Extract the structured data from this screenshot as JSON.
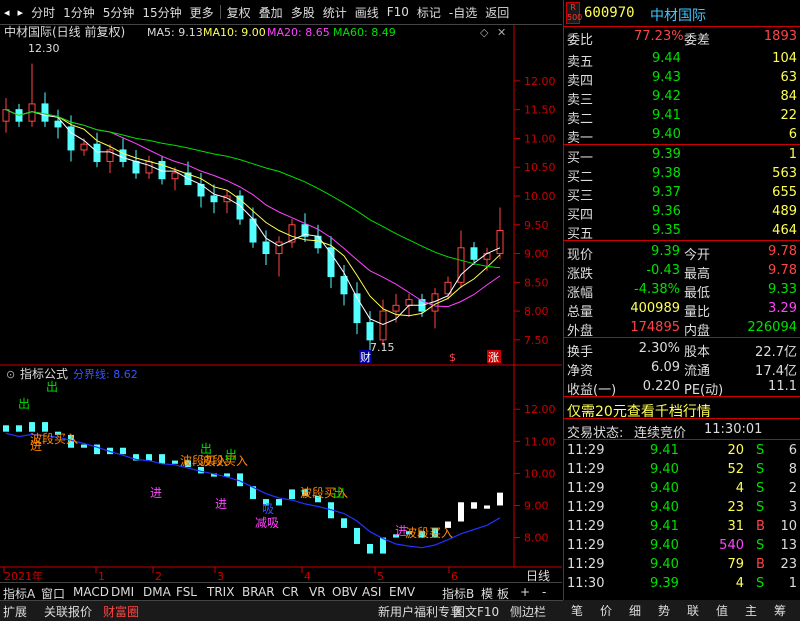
{
  "toolbar": {
    "items": [
      "分时",
      "1分钟",
      "5分钟",
      "15分钟",
      "更多",
      "复权",
      "叠加",
      "多股",
      "统计",
      "画线",
      "F10",
      "标记",
      "-自选",
      "返回"
    ]
  },
  "main_chart": {
    "title": "中材国际(日线 前复权)",
    "ma5": "MA5: 9.13",
    "ma10": "MA10: 9.00",
    "ma20": "MA20: 8.65",
    "ma60": "MA60: 8.49",
    "high_label": "12.30",
    "low_label": "7.15",
    "y_ticks": [
      "12.00",
      "11.50",
      "11.00",
      "10.50",
      "10.00",
      "9.50",
      "9.00",
      "8.50",
      "8.00",
      "7.50"
    ],
    "y_min": 7.15,
    "y_max": 12.45,
    "markers": [
      "财",
      "$",
      "涨"
    ]
  },
  "sub_chart": {
    "title": "指标公式",
    "line_label": "分界线: 8.62",
    "y_ticks": [
      "12.00",
      "11.00",
      "10.00",
      "9.00",
      "8.00"
    ],
    "y_min": 7.3,
    "y_max": 12.6,
    "signals": [
      "出",
      "波段买入",
      "进",
      "进",
      "出",
      "波段买入",
      "进",
      "波段买入",
      "减吸",
      "吸",
      "出",
      "进",
      "波段买入",
      "波段买入",
      "出",
      "出"
    ]
  },
  "x_axis": {
    "labels": [
      "2021年",
      "1",
      "2",
      "3",
      "4",
      "5",
      "6"
    ],
    "right": "日线"
  },
  "chart_data": {
    "type": "candlestick",
    "title": "中材国际(日线 前复权)",
    "x_labels": [
      "2021年",
      "1",
      "2",
      "3",
      "4",
      "5",
      "6"
    ],
    "ylim": [
      7.15,
      12.45
    ],
    "y_ticks": [
      12.0,
      11.5,
      11.0,
      10.5,
      10.0,
      9.5,
      9.0,
      8.5,
      8.0,
      7.5
    ],
    "ohlc": [
      [
        11.3,
        11.7,
        11.1,
        11.5
      ],
      [
        11.5,
        11.6,
        11.2,
        11.3
      ],
      [
        11.3,
        12.3,
        11.2,
        11.6
      ],
      [
        11.6,
        11.8,
        11.2,
        11.3
      ],
      [
        11.3,
        11.5,
        11.0,
        11.2
      ],
      [
        11.2,
        11.4,
        10.6,
        10.8
      ],
      [
        10.8,
        11.0,
        10.7,
        10.9
      ],
      [
        10.9,
        11.1,
        10.5,
        10.6
      ],
      [
        10.6,
        10.9,
        10.4,
        10.8
      ],
      [
        10.8,
        11.0,
        10.5,
        10.6
      ],
      [
        10.6,
        10.8,
        10.3,
        10.4
      ],
      [
        10.4,
        10.7,
        10.3,
        10.6
      ],
      [
        10.6,
        10.7,
        10.2,
        10.3
      ],
      [
        10.3,
        10.5,
        10.1,
        10.4
      ],
      [
        10.4,
        10.6,
        10.2,
        10.2
      ],
      [
        10.2,
        10.4,
        9.8,
        10.0
      ],
      [
        10.0,
        10.2,
        9.7,
        9.9
      ],
      [
        9.9,
        10.1,
        9.7,
        10.0
      ],
      [
        10.0,
        10.1,
        9.5,
        9.6
      ],
      [
        9.6,
        9.8,
        9.1,
        9.2
      ],
      [
        9.2,
        9.4,
        8.8,
        9.0
      ],
      [
        9.0,
        9.3,
        8.6,
        9.2
      ],
      [
        9.2,
        9.6,
        9.1,
        9.5
      ],
      [
        9.5,
        9.7,
        9.2,
        9.3
      ],
      [
        9.3,
        9.5,
        9.0,
        9.1
      ],
      [
        9.1,
        9.3,
        8.4,
        8.6
      ],
      [
        8.6,
        8.8,
        8.1,
        8.3
      ],
      [
        8.3,
        8.5,
        7.6,
        7.8
      ],
      [
        7.8,
        8.0,
        7.15,
        7.5
      ],
      [
        7.5,
        8.2,
        7.4,
        8.0
      ],
      [
        8.0,
        8.3,
        7.8,
        8.1
      ],
      [
        8.1,
        8.3,
        7.9,
        8.2
      ],
      [
        8.2,
        8.3,
        7.9,
        8.0
      ],
      [
        8.0,
        8.4,
        7.7,
        8.3
      ],
      [
        8.3,
        8.6,
        8.2,
        8.5
      ],
      [
        8.5,
        9.4,
        8.4,
        9.1
      ],
      [
        9.1,
        9.2,
        8.8,
        8.9
      ],
      [
        8.9,
        9.1,
        8.7,
        9.0
      ],
      [
        9.0,
        9.8,
        8.9,
        9.4
      ]
    ]
  },
  "quote": {
    "logo_letter": "R",
    "logo_num": "500",
    "code": "600970",
    "name": "中材国际",
    "weibi_label": "委比",
    "weibi": "77.23%",
    "weicha_label": "委差",
    "weicha": "1893",
    "sell": [
      {
        "label": "卖五",
        "price": "9.44",
        "vol": "104"
      },
      {
        "label": "卖四",
        "price": "9.43",
        "vol": "63"
      },
      {
        "label": "卖三",
        "price": "9.42",
        "vol": "84"
      },
      {
        "label": "卖二",
        "price": "9.41",
        "vol": "22"
      },
      {
        "label": "卖一",
        "price": "9.40",
        "vol": "6"
      }
    ],
    "buy": [
      {
        "label": "买一",
        "price": "9.39",
        "vol": "1"
      },
      {
        "label": "买二",
        "price": "9.38",
        "vol": "563"
      },
      {
        "label": "买三",
        "price": "9.37",
        "vol": "655"
      },
      {
        "label": "买四",
        "price": "9.36",
        "vol": "489"
      },
      {
        "label": "买五",
        "price": "9.35",
        "vol": "464"
      }
    ],
    "stats": [
      {
        "l1": "现价",
        "v1": "9.39",
        "c1": "#00e000",
        "l2": "今开",
        "v2": "9.78",
        "c2": "#ff4444"
      },
      {
        "l1": "涨跌",
        "v1": "-0.43",
        "c1": "#00e000",
        "l2": "最高",
        "v2": "9.78",
        "c2": "#ff4444"
      },
      {
        "l1": "涨幅",
        "v1": "-4.38%",
        "c1": "#00e000",
        "l2": "最低",
        "v2": "9.33",
        "c2": "#00e000"
      },
      {
        "l1": "总量",
        "v1": "400989",
        "c1": "#ffff55",
        "l2": "量比",
        "v2": "3.29",
        "c2": "#ff44ff"
      },
      {
        "l1": "外盘",
        "v1": "174895",
        "c1": "#ff4444",
        "l2": "内盘",
        "v2": "226094",
        "c2": "#00e000"
      }
    ],
    "fund": [
      {
        "l1": "换手",
        "v1": "2.30%",
        "l2": "股本",
        "v2": "22.7亿"
      },
      {
        "l1": "净资",
        "v1": "6.09",
        "l2": "流通",
        "v2": "17.4亿"
      },
      {
        "l1": "收益(一)",
        "v1": "0.220",
        "l2": "PE(动)",
        "v2": "11.1"
      }
    ],
    "promo": "仅需20元查看千档行情",
    "status_label": "交易状态:",
    "status": "连续竞价",
    "status_time": "11:30:01",
    "ticks": [
      {
        "t": "11:29",
        "p": "9.41",
        "v": "20",
        "s": "S",
        "n": "6",
        "pc": "#00e000",
        "vc": "#ffff55",
        "sc": "#00e000"
      },
      {
        "t": "11:29",
        "p": "9.40",
        "v": "52",
        "s": "S",
        "n": "8",
        "pc": "#00e000",
        "vc": "#ffff55",
        "sc": "#00e000"
      },
      {
        "t": "11:29",
        "p": "9.40",
        "v": "4",
        "s": "S",
        "n": "2",
        "pc": "#00e000",
        "vc": "#ffff55",
        "sc": "#00e000"
      },
      {
        "t": "11:29",
        "p": "9.40",
        "v": "23",
        "s": "S",
        "n": "3",
        "pc": "#00e000",
        "vc": "#ffff55",
        "sc": "#00e000"
      },
      {
        "t": "11:29",
        "p": "9.41",
        "v": "31",
        "s": "B",
        "n": "10",
        "pc": "#00e000",
        "vc": "#ffff55",
        "sc": "#ff4444"
      },
      {
        "t": "11:29",
        "p": "9.40",
        "v": "540",
        "s": "S",
        "n": "13",
        "pc": "#00e000",
        "vc": "#ff44ff",
        "sc": "#00e000"
      },
      {
        "t": "11:29",
        "p": "9.40",
        "v": "79",
        "s": "B",
        "n": "23",
        "pc": "#00e000",
        "vc": "#ffff55",
        "sc": "#ff4444"
      },
      {
        "t": "11:30",
        "p": "9.39",
        "v": "4",
        "s": "S",
        "n": "1",
        "pc": "#00e000",
        "vc": "#ffff55",
        "sc": "#00e000"
      }
    ]
  },
  "tabs": [
    "指标A",
    "窗口",
    "MACD",
    "DMI",
    "DMA",
    "FSL",
    "TRIX",
    "BRAR",
    "CR",
    "VR",
    "OBV",
    "ASI",
    "EMV",
    "指标B",
    "模",
    "板",
    "+",
    "-"
  ],
  "bottom": [
    "扩展",
    "关联报价",
    "财富圈",
    "新用户福利专享",
    "图文F10",
    "侧边栏"
  ],
  "right_bottom": [
    "笔",
    "价",
    "细",
    "势",
    "联",
    "值",
    "主",
    "筹"
  ],
  "colors": {
    "accent": "#ff0000",
    "green": "#00e000",
    "yellow": "#ffff55",
    "cyan": "#3dc6ff"
  }
}
